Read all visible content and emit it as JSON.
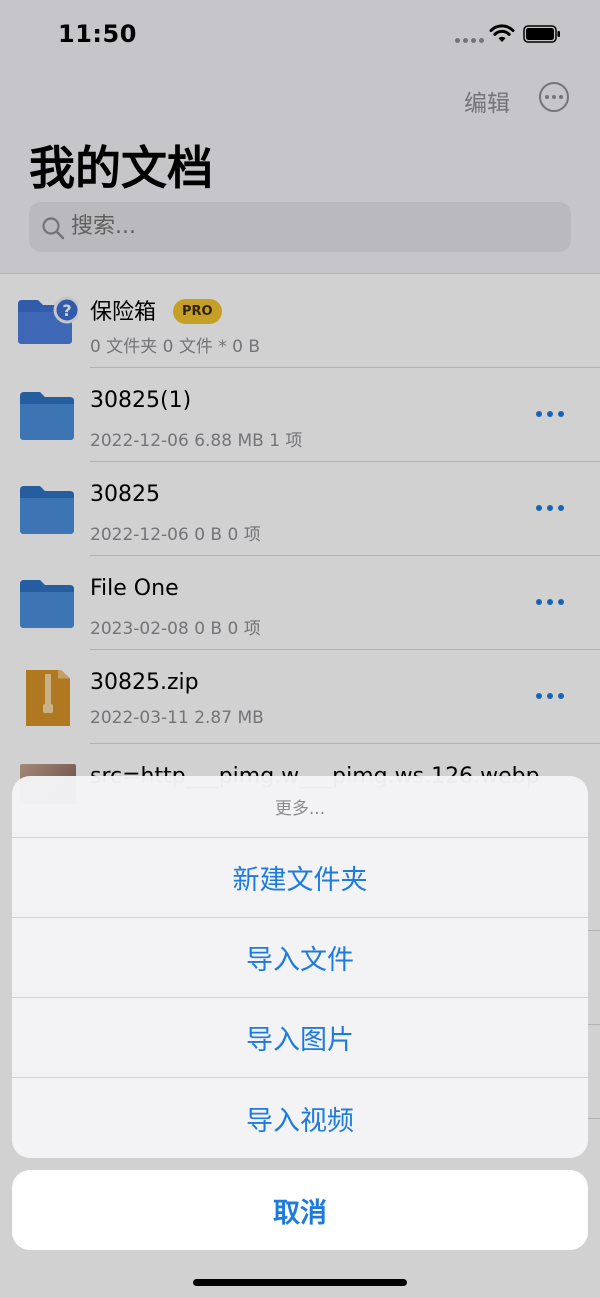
{
  "status_bar": {
    "time": "11:50"
  },
  "nav": {
    "edit_label": "编辑",
    "title": "我的文档"
  },
  "search": {
    "placeholder": "搜索..."
  },
  "files": [
    {
      "name": "保险箱",
      "subtitle": "0 文件夹 0 文件 * 0 B",
      "badge": "PRO",
      "icon": "vault-folder-icon"
    },
    {
      "name": "30825(1)",
      "subtitle": "2022-12-06 6.88 MB  1 项",
      "icon": "folder-icon"
    },
    {
      "name": "30825",
      "subtitle": "2022-12-06 0 B  0 项",
      "icon": "folder-icon"
    },
    {
      "name": "File One",
      "subtitle": "2023-02-08 0 B  0 项",
      "icon": "folder-icon"
    },
    {
      "name": "30825.zip",
      "subtitle": "2022-03-11 2.87 MB",
      "icon": "zip-file-icon"
    }
  ],
  "partial_row": {
    "name": "src=http___pimg.w___pimg.ws.126.webp"
  },
  "action_sheet": {
    "title": "更多...",
    "items": [
      "新建文件夹",
      "导入文件",
      "导入图片",
      "导入视频"
    ],
    "cancel": "取消"
  },
  "colors": {
    "accent": "#1d7be0",
    "folder": "#3d84d6",
    "zip": "#d8932a",
    "pro_badge": "#f2c230"
  }
}
